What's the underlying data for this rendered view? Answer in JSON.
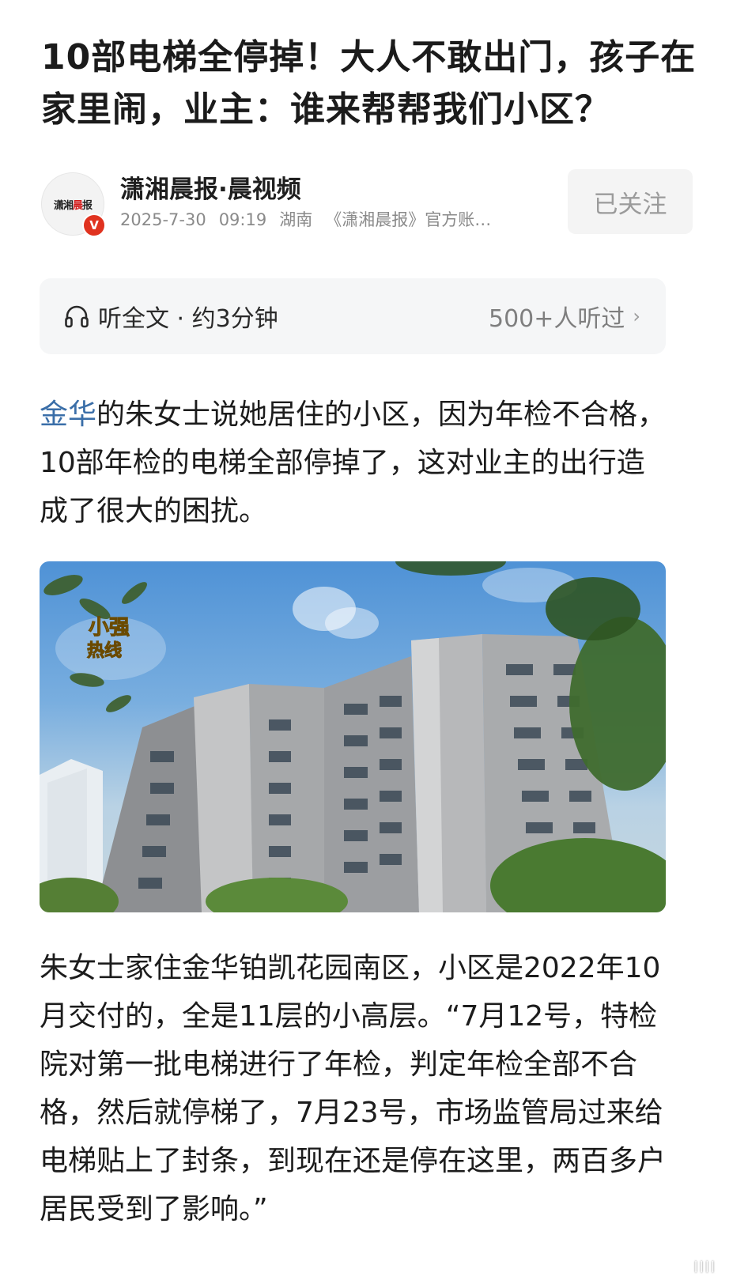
{
  "article": {
    "title": "10部电梯全停掉！大人不敢出门，孩子在家里闹，业主：谁来帮帮我们小区？",
    "author": {
      "name": "潇湘晨报·晨视频",
      "avatar_text_1": "潇湘",
      "avatar_text_2": "晨",
      "avatar_text_3": "报",
      "verified_badge": "V",
      "date": "2025-7-30",
      "time": "09:19",
      "location": "湖南",
      "desc": "《潇湘晨报》官方账…",
      "follow_label": "已关注"
    },
    "listen": {
      "icon": "headphones-icon",
      "label": "听全文 · 约3分钟",
      "count": "500+人听过",
      "chevron": "›"
    },
    "paragraph1": {
      "link": "金华",
      "text": "的朱女士说她居住的小区，因为年检不合格，10部年检的电梯全部停掉了，这对业主的出行造成了很大的困扰。"
    },
    "photo": {
      "logo_line1": "小强",
      "logo_line2": "热线"
    },
    "paragraph2": "朱女士家住金华铂凯花园南区，小区是2022年10月交付的，全是11层的小高层。“7月12号，特检院对第一批电梯进行了年检，判定年检全部不合格，然后就停梯了，7月23号，市场监管局过来给电梯贴上了封条，到现在还是停在这里，两百多户居民受到了影响。”",
    "watermark": "||||"
  },
  "colors": {
    "link": "#3a6ea8",
    "badge": "#e0321f",
    "sky": "#4f92d6"
  }
}
